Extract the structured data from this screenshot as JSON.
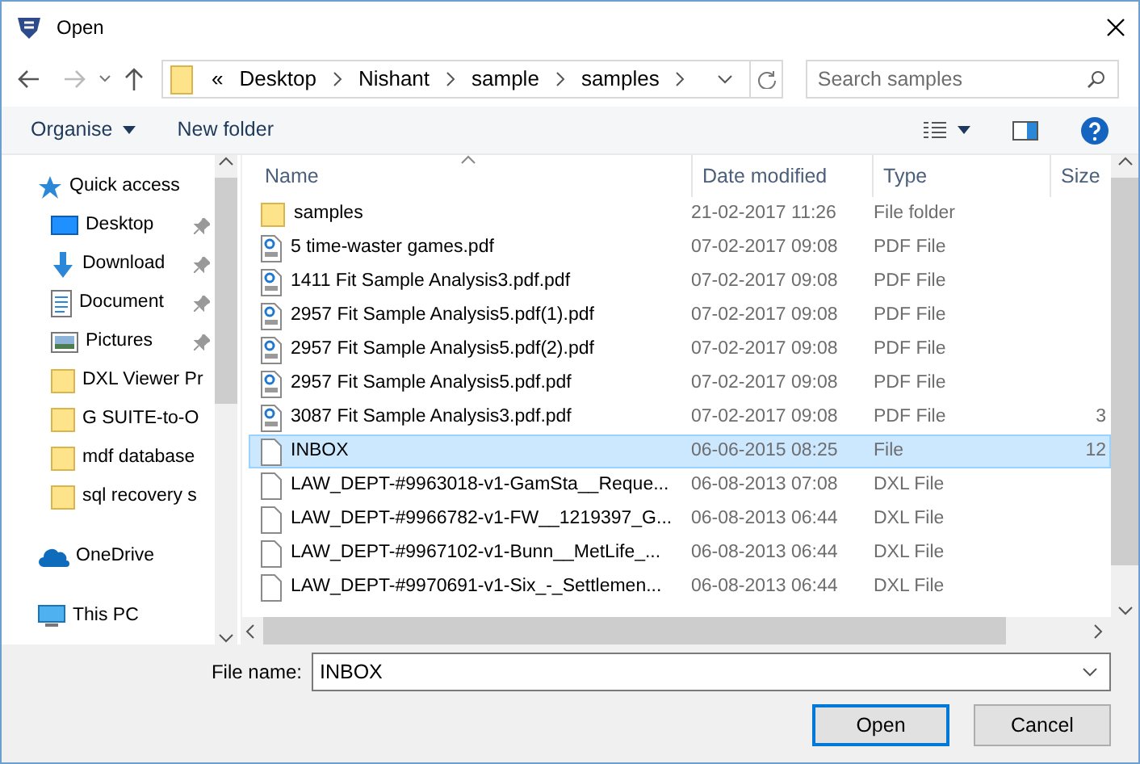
{
  "window": {
    "title": "Open"
  },
  "address_bar": {
    "overflow": "«",
    "path": [
      "Desktop",
      "Nishant",
      "sample",
      "samples"
    ]
  },
  "search": {
    "placeholder": "Search samples"
  },
  "toolbar": {
    "organise": "Organise",
    "new_folder": "New folder"
  },
  "sidebar": {
    "items": [
      {
        "label": "Quick access",
        "kind": "quick",
        "pinned": false
      },
      {
        "label": "Desktop",
        "kind": "desktop",
        "pinned": true
      },
      {
        "label": "Download",
        "kind": "downloads",
        "pinned": true
      },
      {
        "label": "Document",
        "kind": "documents",
        "pinned": true
      },
      {
        "label": "Pictures",
        "kind": "pictures",
        "pinned": true
      },
      {
        "label": "DXL Viewer Pr",
        "kind": "folder",
        "pinned": false
      },
      {
        "label": "G SUITE-to-O",
        "kind": "folder",
        "pinned": false
      },
      {
        "label": "mdf database",
        "kind": "folder",
        "pinned": false
      },
      {
        "label": "sql recovery s",
        "kind": "folder",
        "pinned": false
      },
      {
        "label": "OneDrive",
        "kind": "onedrive",
        "pinned": false
      },
      {
        "label": "This PC",
        "kind": "pc",
        "pinned": false
      }
    ]
  },
  "table": {
    "columns": [
      "Name",
      "Date modified",
      "Type",
      "Size"
    ],
    "rows": [
      {
        "name": "samples",
        "date": "21-02-2017 11:26",
        "type": "File folder",
        "kind": "folder",
        "selected": false
      },
      {
        "name": "5 time-waster games.pdf",
        "date": "07-02-2017 09:08",
        "type": "PDF File",
        "kind": "pdf",
        "selected": false
      },
      {
        "name": "1411 Fit Sample Analysis3.pdf.pdf",
        "date": "07-02-2017 09:08",
        "type": "PDF File",
        "kind": "pdf",
        "selected": false
      },
      {
        "name": "2957 Fit Sample Analysis5.pdf(1).pdf",
        "date": "07-02-2017 09:08",
        "type": "PDF File",
        "kind": "pdf",
        "selected": false
      },
      {
        "name": "2957 Fit Sample Analysis5.pdf(2).pdf",
        "date": "07-02-2017 09:08",
        "type": "PDF File",
        "kind": "pdf",
        "selected": false
      },
      {
        "name": "2957 Fit Sample Analysis5.pdf.pdf",
        "date": "07-02-2017 09:08",
        "type": "PDF File",
        "kind": "pdf",
        "selected": false
      },
      {
        "name": "3087 Fit Sample Analysis3.pdf.pdf",
        "date": "07-02-2017 09:08",
        "type": "PDF File",
        "kind": "pdf",
        "selected": false,
        "size": "3"
      },
      {
        "name": "INBOX",
        "date": "06-06-2015 08:25",
        "type": "File",
        "kind": "file",
        "selected": true,
        "size": "12"
      },
      {
        "name": "LAW_DEPT-#9963018-v1-GamSta__Reque...",
        "date": "06-08-2013 07:08",
        "type": "DXL File",
        "kind": "file",
        "selected": false
      },
      {
        "name": "LAW_DEPT-#9966782-v1-FW__1219397_G...",
        "date": "06-08-2013 06:44",
        "type": "DXL File",
        "kind": "file",
        "selected": false
      },
      {
        "name": "LAW_DEPT-#9967102-v1-Bunn__MetLife_...",
        "date": "06-08-2013 06:44",
        "type": "DXL File",
        "kind": "file",
        "selected": false
      },
      {
        "name": "LAW_DEPT-#9970691-v1-Six_-_Settlemen...",
        "date": "06-08-2013 06:44",
        "type": "DXL File",
        "kind": "file",
        "selected": false
      }
    ]
  },
  "file_name": {
    "label": "File name:",
    "value": "INBOX"
  },
  "buttons": [
    {
      "label": "Open",
      "default": true
    },
    {
      "label": "Cancel",
      "default": false
    }
  ]
}
